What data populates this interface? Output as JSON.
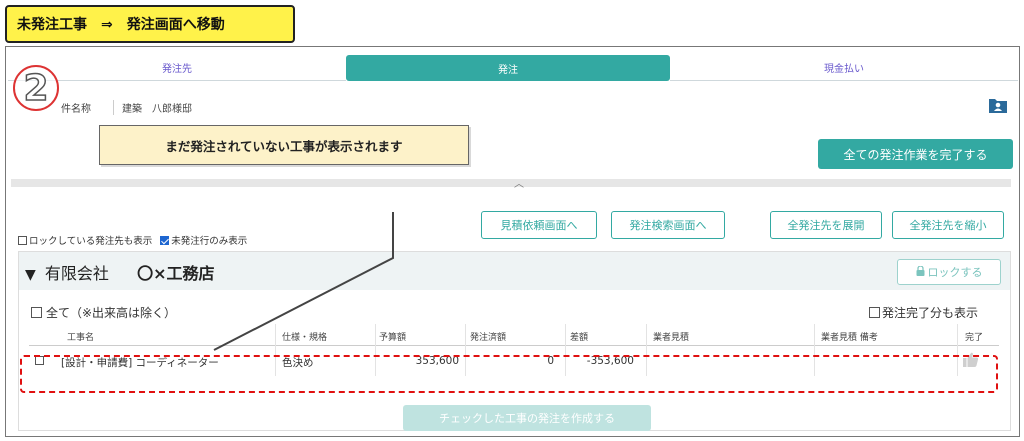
{
  "header_label": "未発注工事　⇒　発注画面へ移動",
  "tabs": [
    {
      "label": "発注先"
    },
    {
      "label": "発注"
    },
    {
      "label": "現金払い"
    }
  ],
  "step_number": "2",
  "project": {
    "label": "件名称",
    "value": "建築　八郎様邸"
  },
  "icons": {
    "folder": "folder-user-icon",
    "lock": "lock-icon",
    "thumb": "thumbs-up-icon"
  },
  "buttons": {
    "complete_all": "全ての発注作業を完了する",
    "estimate_request": "見積依頼画面へ",
    "order_search": "発注検索画面へ",
    "expand_all": "全発注先を展開",
    "collapse_all": "全発注先を縮小",
    "lock": "ロックする",
    "create_order": "チェックした工事の発注を作成する"
  },
  "callout": "まだ発注されていない工事が表示されます",
  "filters": {
    "show_locked": "ロックしている発注先も表示",
    "unordered_only": "未発注行のみ表示"
  },
  "vendor": {
    "prefix": "有限会社",
    "name": "〇×工務店"
  },
  "select_all": "全て（※出来高は除く）",
  "show_completed": "発注完了分も表示",
  "columns": [
    "工事名",
    "仕様・規格",
    "予算額",
    "発注済額",
    "差額",
    "業者見積",
    "業者見積 備考",
    "完了"
  ],
  "rows": [
    {
      "name": "[設計・申請費] コーディネーター",
      "spec": "色決め",
      "budget": "353,600",
      "ordered": "0",
      "diff": "-353,600"
    }
  ],
  "colors": {
    "accent": "#33a9a2",
    "highlight": "#e01010",
    "callout_bg": "#fdf2c9",
    "header_bg": "#fff24a"
  }
}
